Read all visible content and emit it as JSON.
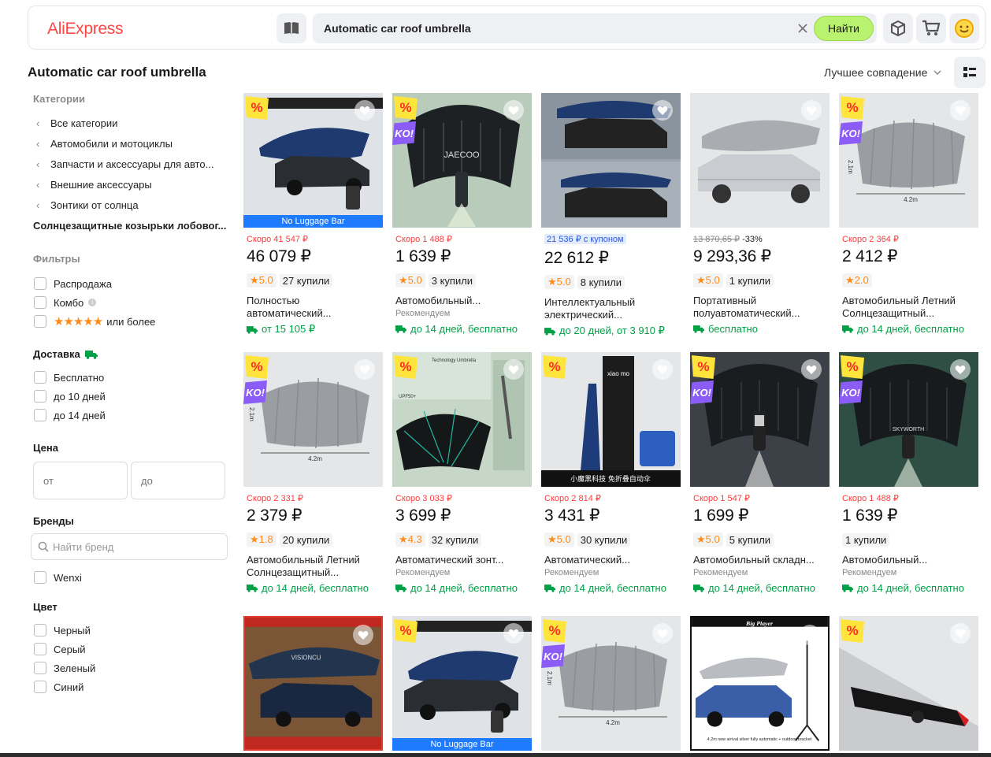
{
  "header": {
    "logo": "AliExpress",
    "search_value": "Automatic car roof umbrella",
    "find_label": "Найти"
  },
  "title": "Automatic car roof umbrella",
  "sort_label": "Лучшее совпадение",
  "sidebar": {
    "categories_head": "Категории",
    "categories": [
      "Все категории",
      "Автомобили и мотоциклы",
      "Запчасти и аксессуары для авто...",
      "Внешние аксессуары",
      "Зонтики от солнца"
    ],
    "active_category": "Солнцезащитные козырьки лобовог...",
    "filters_head": "Фильтры",
    "filters": [
      "Распродажа",
      "Комбо"
    ],
    "rating_suffix": "или более",
    "delivery_head": "Доставка",
    "delivery": [
      "Бесплатно",
      "до 10 дней",
      "до 14 дней"
    ],
    "price_head": "Цена",
    "price_from": "от",
    "price_to": "до",
    "brands_head": "Бренды",
    "brand_placeholder": "Найти бренд",
    "brands": [
      "Wenxi"
    ],
    "color_head": "Цвет",
    "colors": [
      "Черный",
      "Серый",
      "Зеленый",
      "Синий"
    ]
  },
  "products": [
    {
      "old": "Скоро 41 547 ₽",
      "price": "46 079 ₽",
      "rating": "5.0",
      "sold": "27 купили",
      "title": "Полностью автоматический...",
      "rec": "",
      "ship": "от 15 105 ₽",
      "nolug": "No Luggage Bar"
    },
    {
      "old": "Скоро 1 488 ₽",
      "price": "1 639 ₽",
      "rating": "5.0",
      "sold": "3 купили",
      "title": "Автомобильный...",
      "rec": "Рекомендуем",
      "ship": "до 14 дней, бесплатно",
      "img_text": "JAECOO"
    },
    {
      "old": "21 536 ₽ с купоном",
      "price": "22 612 ₽",
      "rating": "5.0",
      "sold": "8 купили",
      "title": "Интеллектуальный электрический...",
      "rec": "",
      "ship": "до 20 дней, от 3 910 ₽"
    },
    {
      "old": "13 870,65 ₽",
      "old_pct": "-33%",
      "price": "9 293,36 ₽",
      "rating": "5.0",
      "sold": "1 купили",
      "title": "Портативный полуавтоматический...",
      "rec": "",
      "ship": "бесплатно"
    },
    {
      "old": "Скоро 2 364 ₽",
      "price": "2 412 ₽",
      "rating": "2.0",
      "sold": "",
      "title": "Автомобильный Летний Солнцезащитный...",
      "rec": "",
      "ship": "до 14 дней, бесплатно",
      "img_text": "4.2m",
      "img_text2": "2.1m"
    },
    {
      "old": "Скоро 2 331 ₽",
      "price": "2 379 ₽",
      "rating": "1.8",
      "sold": "20 купили",
      "title": "Автомобильный Летний Солнцезащитный...",
      "rec": "",
      "ship": "до 14 дней, бесплатно",
      "img_text": "4.2m",
      "img_text2": "2.1m"
    },
    {
      "old": "Скоро 3 033 ₽",
      "price": "3 699 ₽",
      "rating": "4.3",
      "sold": "32 купили",
      "title": "Автоматический зонт...",
      "rec": "Рекомендуем",
      "ship": "до 14 дней, бесплатно",
      "img_text": "Technology Umbrella",
      "img_text2": "UPF50+"
    },
    {
      "old": "Скоро 2 814 ₽",
      "price": "3 431 ₽",
      "rating": "5.0",
      "sold": "30 купили",
      "title": "Автоматический...",
      "rec": "Рекомендуем",
      "ship": "до 14 дней, бесплатно",
      "img_text": "xiao mo",
      "img_text2": "小魔黑科技 免折叠自动伞"
    },
    {
      "old": "Скоро 1 547 ₽",
      "price": "1 699 ₽",
      "rating": "5.0",
      "sold": "5 купили",
      "title": "Автомобильный складн...",
      "rec": "Рекомендуем",
      "ship": "до 14 дней, бесплатно"
    },
    {
      "old": "Скоро 1 488 ₽",
      "price": "1 639 ₽",
      "rating": "",
      "sold": "1 купили",
      "title": "Автомобильный...",
      "rec": "Рекомендуем",
      "ship": "до 14 дней, бесплатно",
      "img_text": "SKYWORTH"
    },
    {
      "img_text": "VISIONCU"
    },
    {
      "nolug": "No Luggage Bar"
    },
    {
      "img_text": "4.2m",
      "img_text2": "2.1m"
    },
    {
      "img_text": "Big Player",
      "img_text2": "4.2m new arrival silver fully automatic + outdoor bracket"
    },
    {}
  ],
  "colors": {
    "brand_red": "#ff4747",
    "find_green": "#b9f26e",
    "price_red": "#ff3a3a",
    "ship_green": "#00a046",
    "rating_orange": "#ff8c1a",
    "ko_purple": "#8b5cf6",
    "pct_yellow": "#ffe53b"
  }
}
